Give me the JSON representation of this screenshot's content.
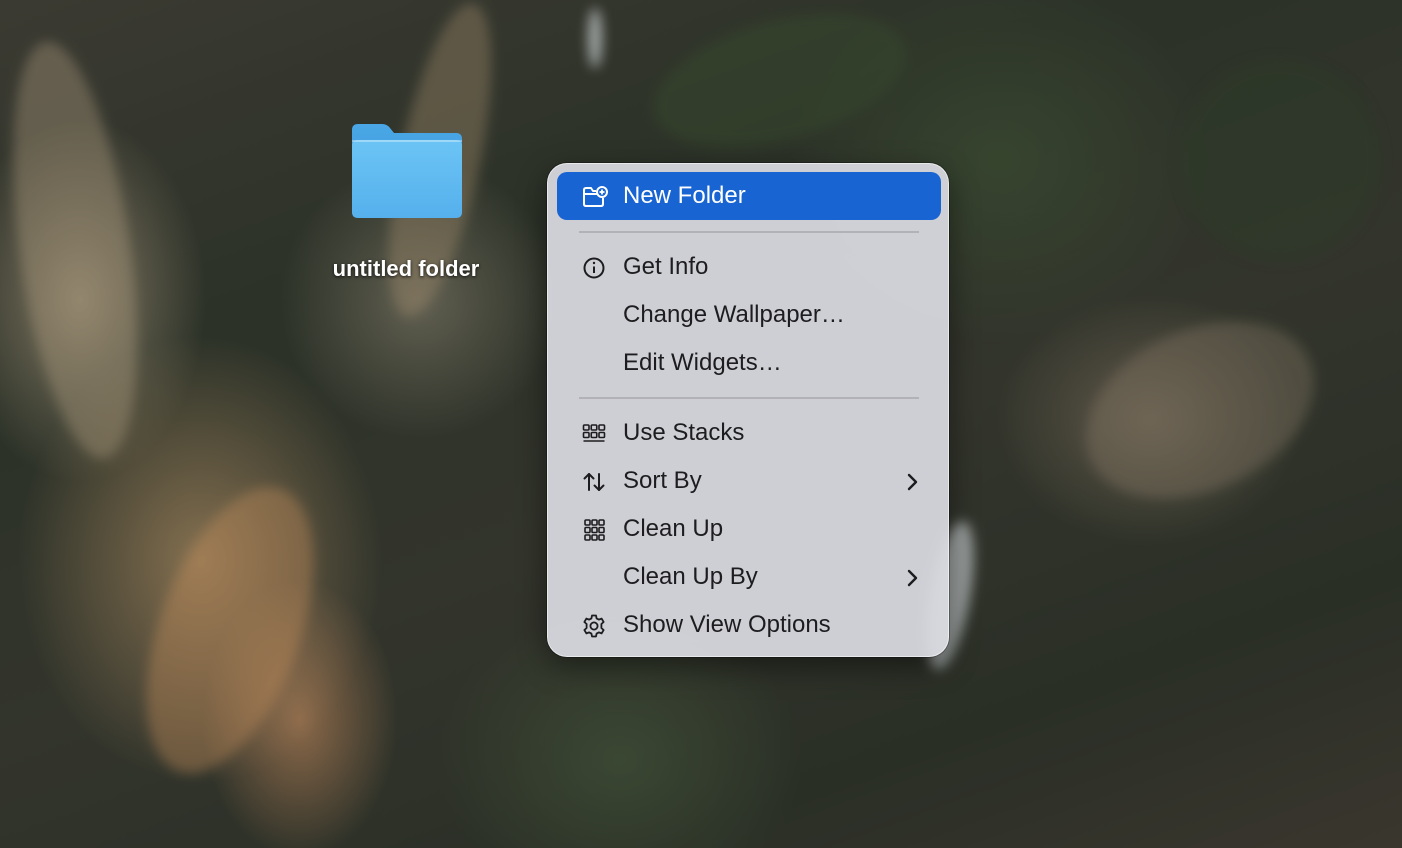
{
  "desktop": {
    "folder": {
      "label": "untitled folder"
    }
  },
  "context_menu": {
    "items": [
      {
        "label": "New Folder",
        "icon": "new-folder-icon",
        "selected": true
      },
      {
        "label": "Get Info",
        "icon": "info-circle-icon"
      },
      {
        "label": "Change Wallpaper…"
      },
      {
        "label": "Edit Widgets…"
      },
      {
        "label": "Use Stacks",
        "icon": "stacks-icon"
      },
      {
        "label": "Sort By",
        "icon": "sort-arrows-icon",
        "submenu": true
      },
      {
        "label": "Clean Up",
        "icon": "grid-dots-icon"
      },
      {
        "label": "Clean Up By",
        "submenu": true
      },
      {
        "label": "Show View Options",
        "icon": "gear-icon"
      }
    ]
  },
  "colors": {
    "selection_accent": "#1764d2",
    "folder_blue": "#5ab4ee"
  }
}
